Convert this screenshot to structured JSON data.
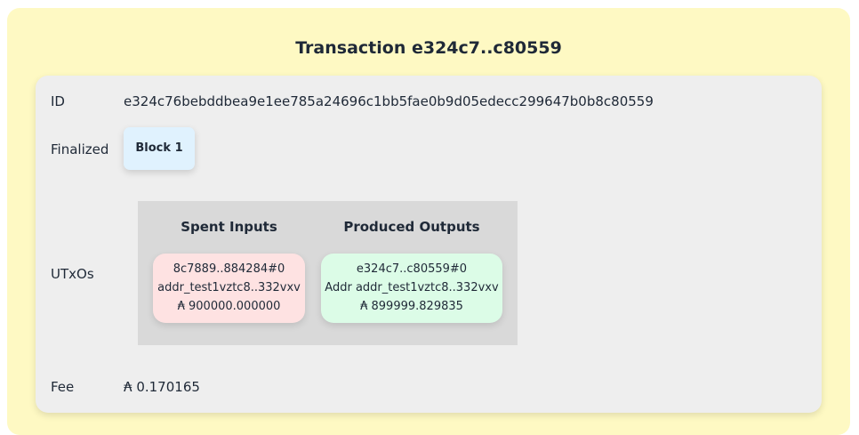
{
  "title": "Transaction e324c7..c80559",
  "colors": {
    "outer_background": "#fef9c3",
    "card_background": "#eeeeee",
    "block_badge": "#e0f2fe",
    "spent_input": "#fee2e2",
    "produced_output": "#dcfce7",
    "utxo_panel": "#d9d9d9"
  },
  "id": {
    "label": "ID",
    "value": "e324c76bebddbea9e1ee785a24696c1bb5fae0b9d05edecc299647b0b8c80559"
  },
  "finalized": {
    "label": "Finalized",
    "block": "Block 1"
  },
  "utxos": {
    "label": "UTxOs",
    "spent_heading": "Spent Inputs",
    "produced_heading": "Produced Outputs",
    "inputs": [
      {
        "ref": "8c7889..884284#0",
        "address": "addr_test1vztc8..332vxv",
        "currency_symbol": "₳",
        "amount": "900000.000000"
      }
    ],
    "outputs": [
      {
        "ref": "e324c7..c80559#0",
        "address": "Addr addr_test1vztc8..332vxv",
        "currency_symbol": "₳",
        "amount": "899999.829835"
      }
    ]
  },
  "fee": {
    "label": "Fee",
    "currency_symbol": "₳",
    "amount": "0.170165"
  }
}
